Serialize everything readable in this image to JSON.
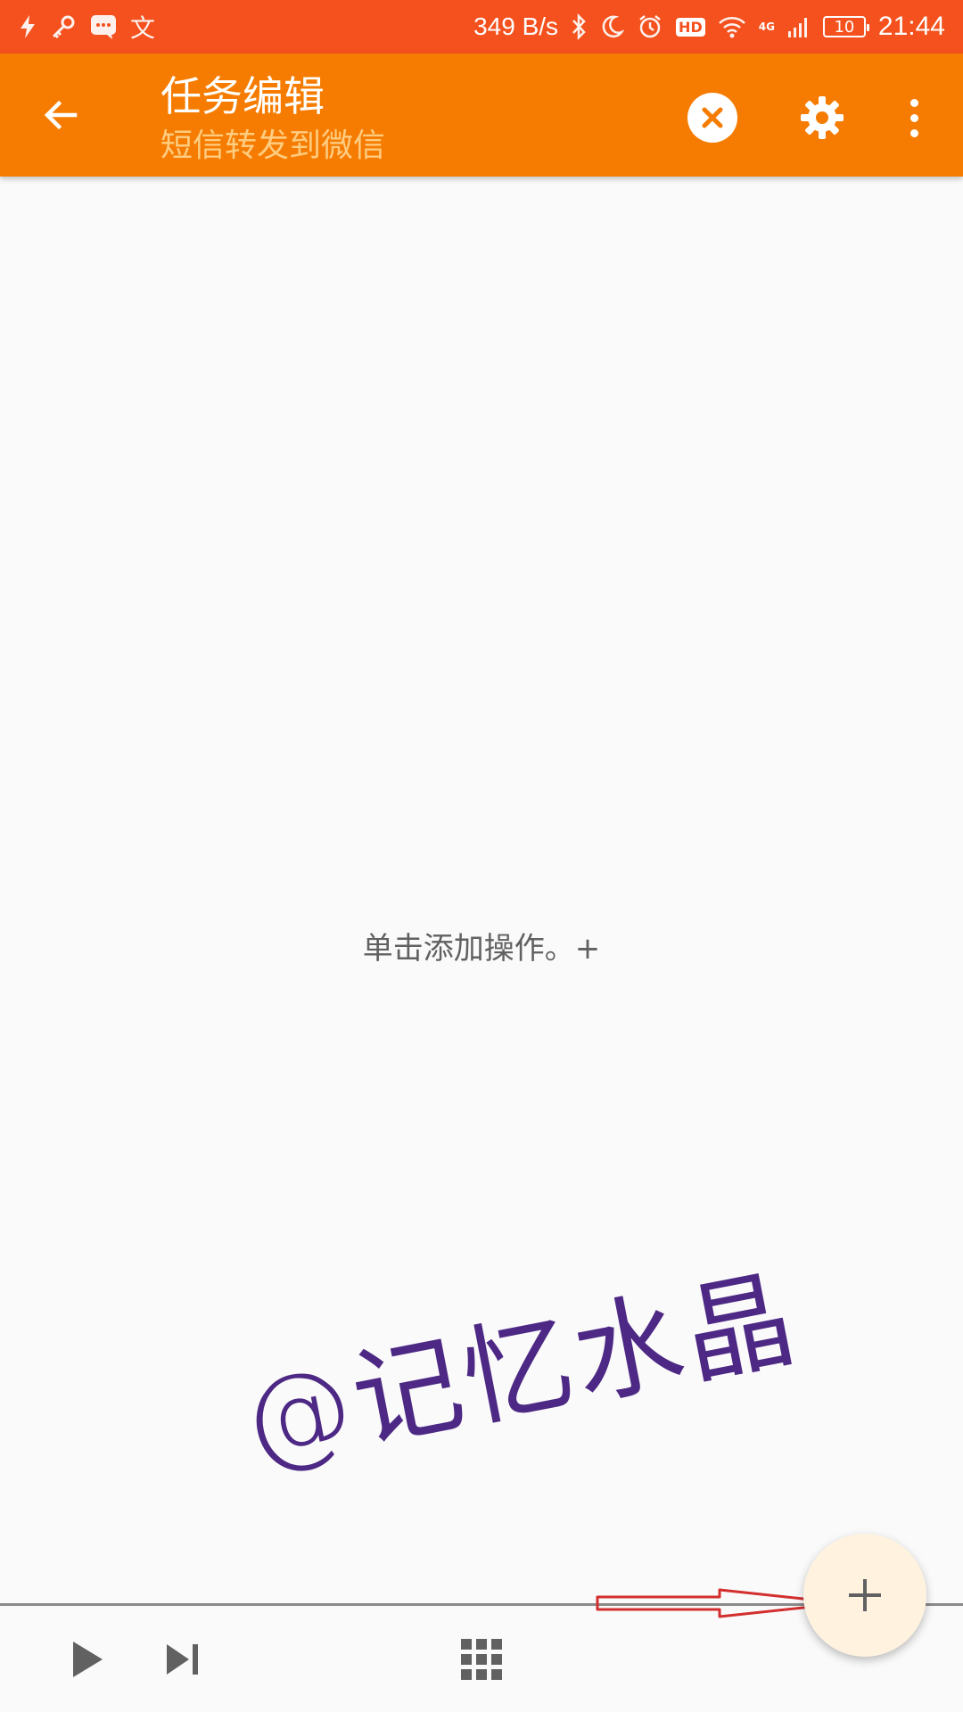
{
  "status_bar": {
    "left_icons": [
      "flash-icon",
      "key-icon",
      "message-icon",
      "translate-icon"
    ],
    "left_glyph_translate": "文",
    "network_speed": "349 B/s",
    "right_icons": [
      "bluetooth-icon",
      "moon-icon",
      "alarm-icon",
      "hd-icon",
      "wifi-icon",
      "signal-icon",
      "battery-icon"
    ],
    "hd_label": "HD",
    "network_type": "4G",
    "battery_level": "10",
    "time": "21:44",
    "background_color": "#f4511e"
  },
  "app_bar": {
    "title": "任务编辑",
    "subtitle": "短信转发到微信",
    "background_color": "#f57c00",
    "subtitle_color": "#ffcc80"
  },
  "main": {
    "empty_hint": "单击添加操作。+"
  },
  "watermark": {
    "text": "@记忆水晶",
    "color": "#3b1278"
  },
  "fab": {
    "icon": "plus-icon",
    "background_color": "#fff3e0"
  },
  "annotation": {
    "arrow_color": "#d32f2f"
  },
  "bottom_bar": {
    "buttons": [
      "play-icon",
      "skip-next-icon",
      "grid-icon"
    ]
  }
}
